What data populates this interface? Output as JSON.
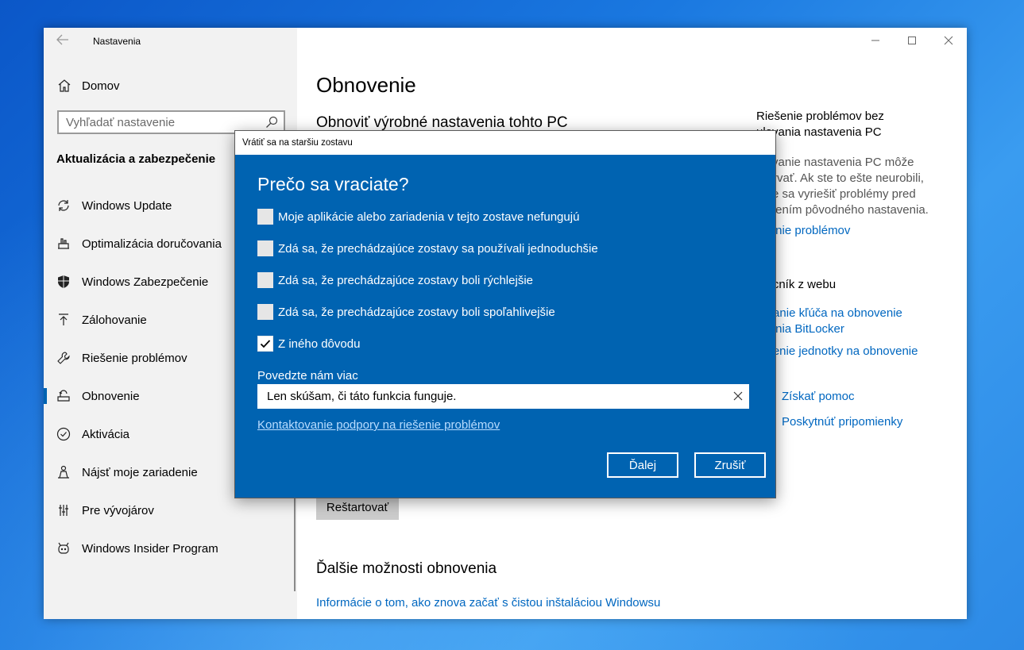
{
  "app": {
    "title": "Nastavenia"
  },
  "sidebar": {
    "home_label": "Domov",
    "search_placeholder": "Vyhľadať nastavenie",
    "section_title": "Aktualizácia a zabezpečenie",
    "items": [
      {
        "label": "Windows Update",
        "icon": "refresh-icon"
      },
      {
        "label": "Optimalizácia doručovania",
        "icon": "delivery-icon"
      },
      {
        "label": "Windows Zabezpečenie",
        "icon": "shield-icon"
      },
      {
        "label": "Zálohovanie",
        "icon": "upload-arrow-icon"
      },
      {
        "label": "Riešenie problémov",
        "icon": "wrench-icon"
      },
      {
        "label": "Obnovenie",
        "icon": "recovery-icon",
        "active": true
      },
      {
        "label": "Aktivácia",
        "icon": "check-circle-icon"
      },
      {
        "label": "Nájsť moje zariadenie",
        "icon": "person-locate-icon"
      },
      {
        "label": "Pre vývojárov",
        "icon": "developer-icon"
      },
      {
        "label": "Windows Insider Program",
        "icon": "insider-icon"
      }
    ]
  },
  "content": {
    "page_title": "Obnovenie",
    "reset_heading": "Obnoviť výrobné nastavenia tohto PC",
    "restart_button": "Reštartovať",
    "more_options_heading": "Ďalšie možnosti obnovenia",
    "clean_install_link": "Informácie o tom, ako znova začať s čistou inštaláciou Windowsu"
  },
  "right_col": {
    "title_line1": "Riešenie problémov bez",
    "title_line2": "ulovania nastavenia PC",
    "text_line1": "ulovanie nastavenia PC môže",
    "text_line2": "ľu trvať. Ak ste to ešte neurobili,",
    "text_line3": "úste sa vyriešiť problémy pred",
    "text_line4": "novením pôvodného nastavenia.",
    "troubleshoot_link": "ešenie problémov",
    "web_help_title": "mocník z webu",
    "web_link1_line1": "ľadanie kľúča na obnovenie",
    "web_link1_line2": "ovania BitLocker",
    "web_link2": "vorenie jednotky na obnovenie",
    "get_help": "Získať pomoc",
    "feedback": "Poskytnúť pripomienky"
  },
  "dialog": {
    "title": "Vrátiť sa na staršiu zostavu",
    "heading": "Prečo sa vraciate?",
    "options": [
      {
        "label": "Moje aplikácie alebo zariadenia v tejto zostave nefungujú",
        "checked": false
      },
      {
        "label": "Zdá sa, že prechádzajúce zostavy sa používali jednoduchšie",
        "checked": false
      },
      {
        "label": "Zdá sa, že prechádzajúce zostavy boli rýchlejšie",
        "checked": false
      },
      {
        "label": "Zdá sa, že prechádzajúce zostavy boli spoľahlivejšie",
        "checked": false
      },
      {
        "label": "Z iného dôvodu",
        "checked": true
      }
    ],
    "tell_us_label": "Povedzte nám viac",
    "tell_us_value": "Len skúšam, či táto funkcia funguje.",
    "support_link": "Kontaktovanie podpory na riešenie problémov",
    "next_button": "Ďalej",
    "cancel_button": "Zrušiť"
  }
}
